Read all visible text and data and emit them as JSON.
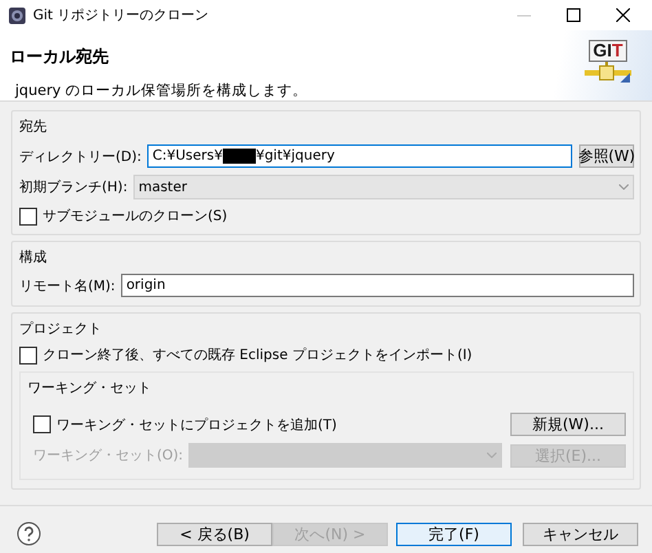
{
  "window": {
    "title": "Git リポジトリーのクローン"
  },
  "header": {
    "title": "ローカル宛先",
    "description": "jquery のローカル保管場所を構成します。",
    "logo_letters": [
      {
        "char": "G",
        "color": "#1a1a1a"
      },
      {
        "char": "I",
        "color": "#1a1a1a"
      },
      {
        "char": "T",
        "color": "#c0282d"
      }
    ]
  },
  "destination": {
    "label": "宛先",
    "directory": {
      "label": "ディレクトリー(D):",
      "value_start": "C:¥Users¥",
      "redacted": true,
      "value_end": "¥git¥jquery"
    },
    "browse_button": "参照(W)",
    "initial_branch": {
      "label": "初期ブランチ(H):",
      "value": "master"
    },
    "clone_submodules": {
      "label": "サブモジュールのクローン(S)",
      "checked": false
    }
  },
  "configuration": {
    "label": "構成",
    "remote_name": {
      "label": "リモート名(M):",
      "value": "origin"
    }
  },
  "projects": {
    "label": "プロジェクト",
    "import_projects": {
      "label": "クローン終了後、すべての既存 Eclipse プロジェクトをインポート(I)",
      "checked": false
    },
    "working_sets": {
      "label": "ワーキング・セット",
      "add_to_working_set": {
        "label": "ワーキング・セットにプロジェクトを追加(T)",
        "checked": false
      },
      "new_button": {
        "label": "新規(W)...",
        "disabled": false
      },
      "working_set_combo": {
        "label": "ワーキング・セット(O):",
        "disabled": true
      },
      "select_button": {
        "label": "選択(E)...",
        "disabled": true
      }
    }
  },
  "buttons": [
    {
      "label": "< 戻る(B)",
      "disabled": false,
      "default": false
    },
    {
      "label": "次へ(N) >",
      "disabled": true,
      "default": false
    },
    {
      "label": "完了(F)",
      "disabled": false,
      "default": true
    },
    {
      "label": "キャンセル",
      "disabled": false,
      "default": false
    }
  ]
}
